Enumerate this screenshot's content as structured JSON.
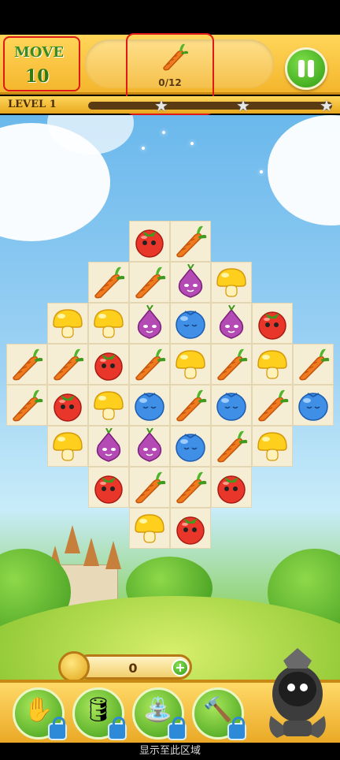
{
  "header": {
    "move_label": "MOVE",
    "move_value": "10",
    "goal_item": "carrot",
    "goal_count": "0/12",
    "level_label": "LEVEL 1",
    "level_progress": 0,
    "pause_icon": "pause-icon"
  },
  "board": {
    "pieces": [
      "tomato",
      "carrot",
      "onion",
      "carrot",
      "mushroom",
      "blueberry"
    ]
  },
  "coins": {
    "value": "0",
    "plus_label": "+"
  },
  "boosters": [
    {
      "name": "glove",
      "locked": true
    },
    {
      "name": "barrel",
      "locked": true
    },
    {
      "name": "watering-can",
      "locked": true
    },
    {
      "name": "hammer",
      "locked": true
    }
  ],
  "footer": {
    "hint": "显示至此区域"
  },
  "colors": {
    "accent": "#f4b52c",
    "button_green": "#2e9a12",
    "highlight_red": "#e01818"
  }
}
